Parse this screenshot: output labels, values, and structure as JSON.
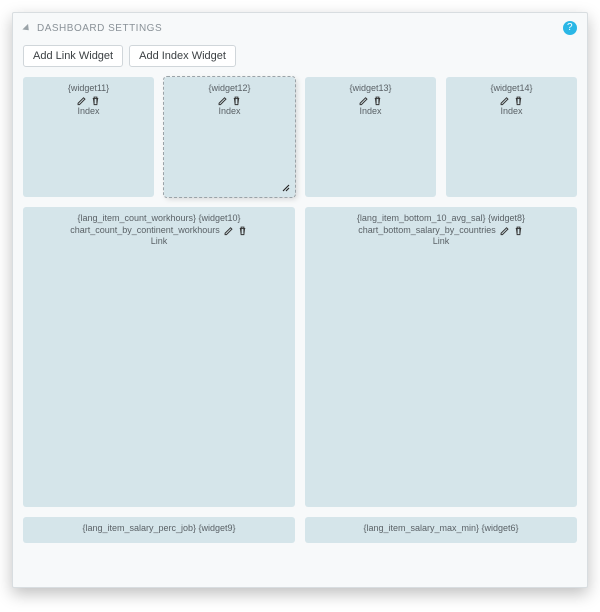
{
  "header": {
    "title": "DASHBOARD SETTINGS",
    "help_symbol": "?"
  },
  "toolbar": {
    "add_link_label": "Add Link Widget",
    "add_index_label": "Add Index Widget"
  },
  "small_widgets": [
    {
      "name": "{widget11}",
      "type": "Index",
      "selected": false
    },
    {
      "name": "{widget12}",
      "type": "Index",
      "selected": true
    },
    {
      "name": "{widget13}",
      "type": "Index",
      "selected": false
    },
    {
      "name": "{widget14}",
      "type": "Index",
      "selected": false
    }
  ],
  "large_widgets": [
    {
      "title_line1": "{lang_item_count_workhours} {widget10}",
      "title_line2": "chart_count_by_continent_workhours",
      "type": "Link"
    },
    {
      "title_line1": "{lang_item_bottom_10_avg_sal} {widget8}",
      "title_line2": "chart_bottom_salary_by_countries",
      "type": "Link"
    }
  ],
  "stub_widgets": [
    {
      "title": "{lang_item_salary_perc_job} {widget9}"
    },
    {
      "title": "{lang_item_salary_max_min} {widget6}"
    }
  ]
}
